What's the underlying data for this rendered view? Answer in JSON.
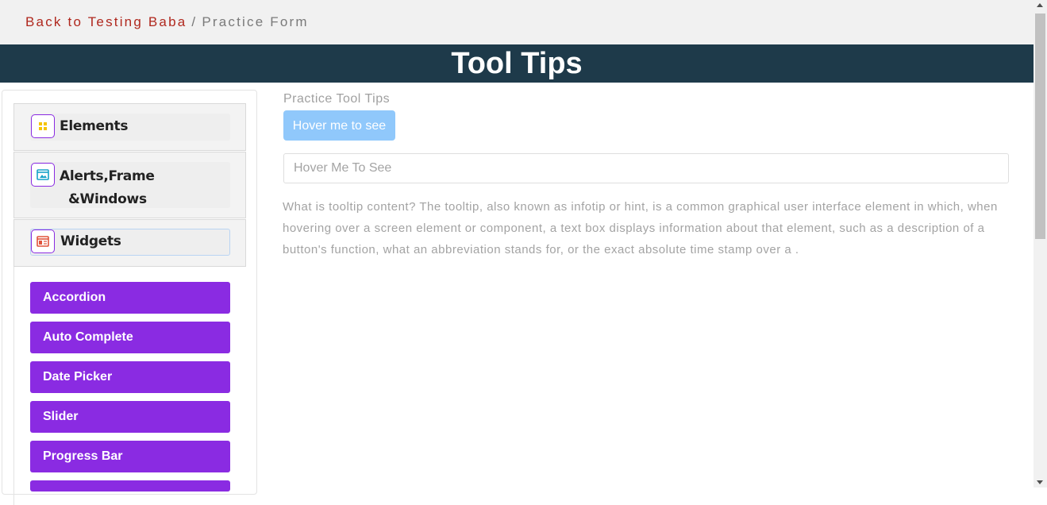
{
  "breadcrumb": {
    "link": "Back to Testing Baba",
    "separator": "/",
    "current": "Practice Form"
  },
  "banner": {
    "title": "Tool Tips"
  },
  "sidebar": {
    "groups": [
      {
        "label": "Elements",
        "icon": "elements-grid-icon"
      },
      {
        "label": "Alerts,Frame\n&Windows",
        "icon": "window-icon"
      },
      {
        "label": "Widgets",
        "icon": "widgets-icon"
      }
    ],
    "widgets": [
      "Accordion",
      "Auto Complete",
      "Date Picker",
      "Slider",
      "Progress Bar"
    ]
  },
  "main": {
    "section_label": "Practice Tool Tips",
    "button_label": "Hover me to see",
    "input_placeholder": "Hover Me To See",
    "paragraph": "What is tooltip content? The tooltip, also known as infotip or hint, is a common graphical user interface element in which, when hovering over a screen element or component, a text box displays information about that element, such as a description of a button's function, what an abbreviation stands for, or the exact absolute time stamp over a ."
  },
  "colors": {
    "banner_bg": "#1e3a4a",
    "accent_purple": "#8a2be2",
    "link_red": "#b0281e",
    "button_blue": "#90c8fb"
  }
}
